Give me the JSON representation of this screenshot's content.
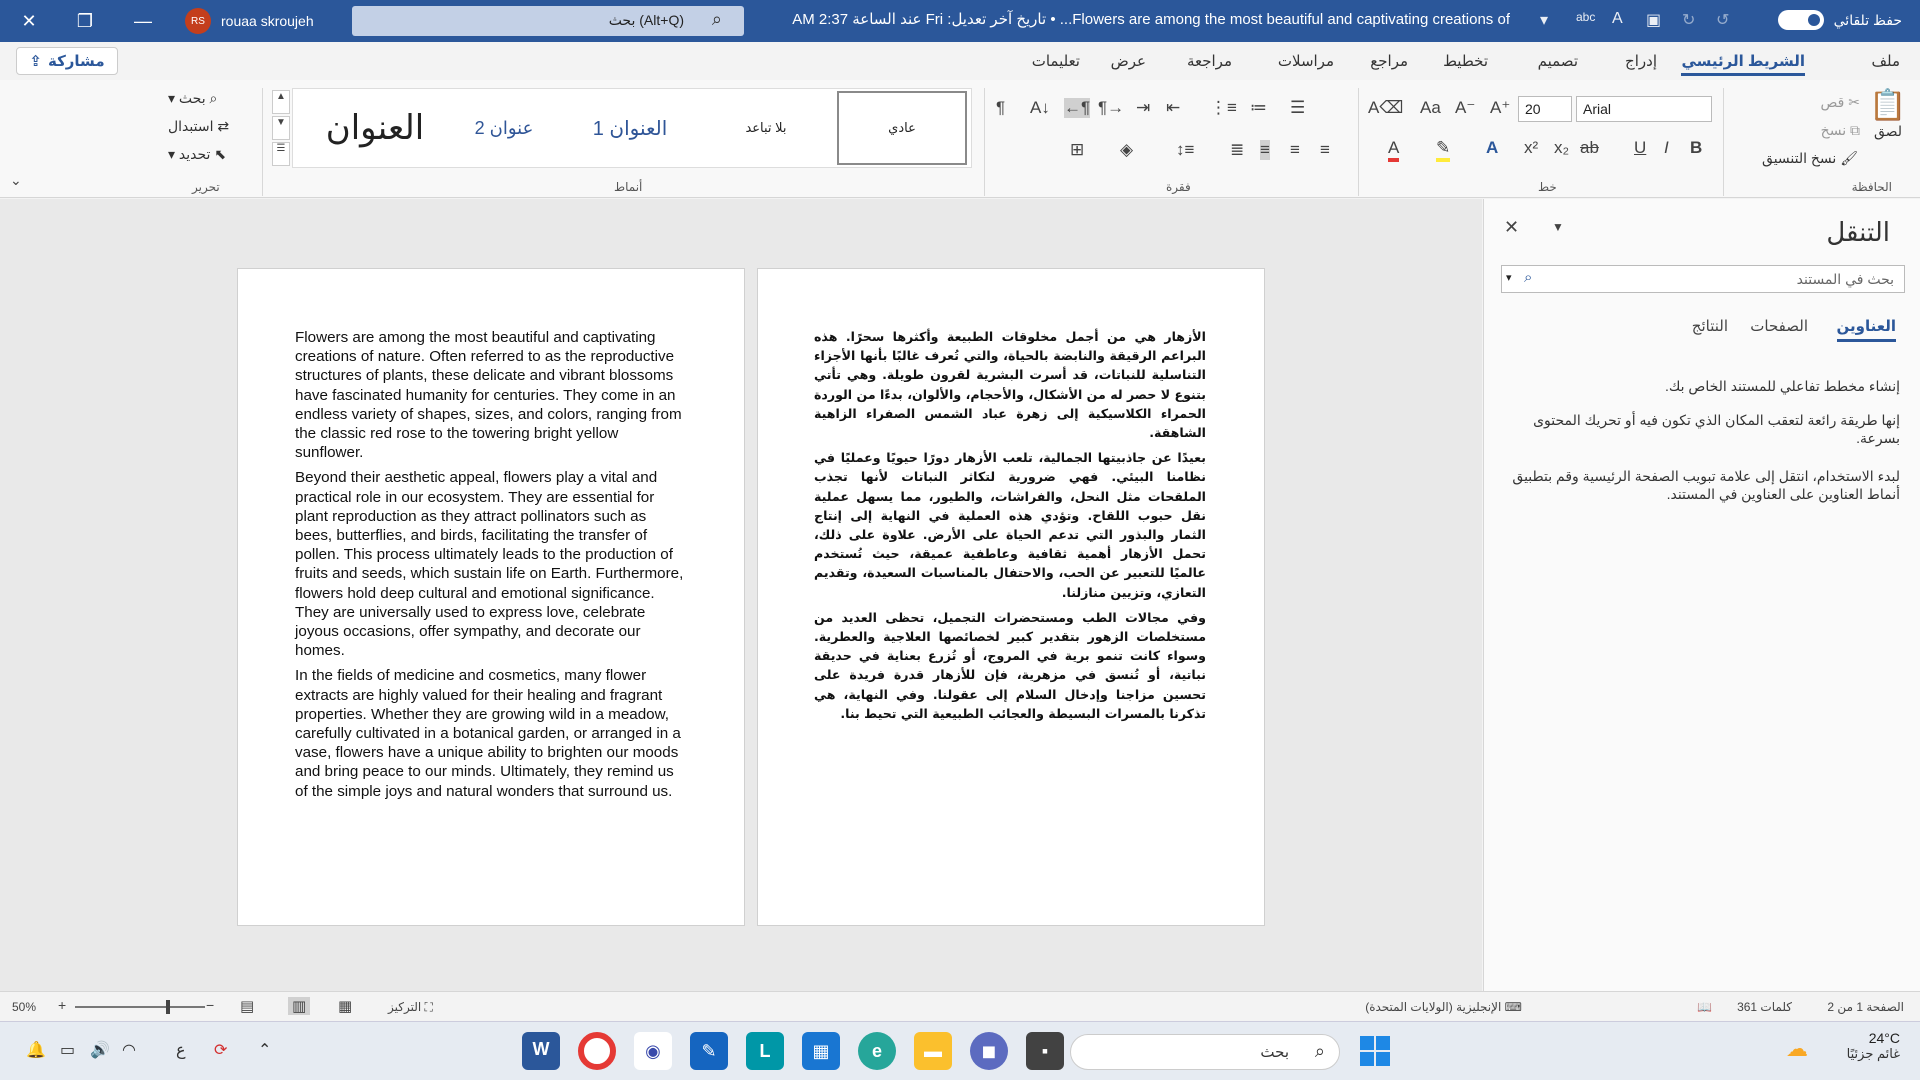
{
  "titlebar": {
    "doc_title": "Flowers are among the most beautiful and captivating creations of... • تاريخ آخر تعديل: Fri عند الساعة 2:37 AM",
    "search_placeholder": "بحث (Alt+Q)",
    "user_name": "rouaa skroujeh",
    "user_initials": "RS",
    "autosave_label": "حفظ تلقائي"
  },
  "tabs": [
    "ملف",
    "الشريط الرئيسي",
    "إدراج",
    "تصميم",
    "تخطيط",
    "مراجع",
    "مراسلات",
    "مراجعة",
    "عرض",
    "تعليمات"
  ],
  "share_label": "مشاركة",
  "ribbon": {
    "clipboard": {
      "label": "الحافظة",
      "paste": "لصق",
      "cut": "قص",
      "copy": "نسخ",
      "format_painter": "نسخ التنسيق"
    },
    "font": {
      "label": "خط",
      "name": "Arial",
      "size": "20"
    },
    "paragraph": {
      "label": "فقرة"
    },
    "styles": {
      "label": "أنماط",
      "items": [
        "عادي",
        "بلا تباعد",
        "العنوان 1",
        "عنوان 2",
        "العنوان"
      ]
    },
    "editing": {
      "label": "تحرير",
      "find": "بحث",
      "replace": "استبدال",
      "select": "تحديد"
    }
  },
  "document": {
    "english_paragraphs": [
      "Flowers are among the most beautiful and captivating creations of nature. Often referred to as the reproductive structures of plants, these delicate and vibrant blossoms have fascinated humanity for centuries. They come in an endless variety of shapes, sizes, and colors, ranging from the classic red rose to the towering bright yellow sunflower.",
      "Beyond their aesthetic appeal, flowers play a vital and practical role in our ecosystem. They are essential for plant reproduction as they attract pollinators such as bees, butterflies, and birds, facilitating the transfer of pollen. This process ultimately leads to the production of fruits and seeds, which sustain life on Earth. Furthermore, flowers hold deep cultural and emotional significance. They are universally used to express love, celebrate joyous occasions, offer sympathy, and decorate our homes.",
      "In the fields of medicine and cosmetics, many flower extracts are highly valued for their healing and fragrant properties. Whether they are growing wild in a meadow, carefully cultivated in a botanical garden, or arranged in a vase, flowers have a unique ability to brighten our moods and bring peace to our minds. Ultimately, they remind us of the simple joys and natural wonders that surround us."
    ],
    "arabic_paragraphs": [
      "الأزهار هي من أجمل مخلوقات الطبيعة وأكثرها سحرًا. هذه البراعم الرقيقة والنابضة بالحياة، والتي تُعرف غالبًا بأنها الأجزاء التناسلية للنباتات، قد أسرت البشرية لقرون طويلة. وهي تأتي بتنوع لا حصر له من الأشكال، والأحجام، والألوان، بدءًا من الوردة الحمراء الكلاسيكية إلى زهرة عباد الشمس الصفراء الزاهية الشاهقة.",
      "بعيدًا عن جاذبيتها الجمالية، تلعب الأزهار دورًا حيويًا وعمليًا في نظامنا البيئي. فهي ضرورية لتكاثر النباتات لأنها تجذب الملقحات مثل النحل، والفراشات، والطيور، مما يسهل عملية نقل حبوب اللقاح. وتؤدي هذه العملية في النهاية إلى إنتاج الثمار والبذور التي تدعم الحياة على الأرض. علاوة على ذلك، تحمل الأزهار أهمية ثقافية وعاطفية عميقة، حيث تُستخدم عالميًا للتعبير عن الحب، والاحتفال بالمناسبات السعيدة، وتقديم التعازي، وتزيين منازلنا.",
      "وفي مجالات الطب ومستحضرات التجميل، تحظى العديد من مستخلصات الزهور بتقدير كبير لخصائصها العلاجية والعطرية. وسواء كانت تنمو برية في المروج، أو تُزرع بعناية في حديقة نباتية، أو تُنسق في مزهرية، فإن للأزهار قدرة فريدة على تحسين مزاجنا وإدخال السلام إلى عقولنا. وفي النهاية، هي تذكرنا بالمسرات البسيطة والعجائب الطبيعية التي تحيط بنا."
    ]
  },
  "navpane": {
    "title": "التنقل",
    "search_placeholder": "بحث في المستند",
    "tabs": [
      "العناوين",
      "الصفحات",
      "النتائج"
    ],
    "help_1": "إنشاء مخطط تفاعلي للمستند الخاص بك.",
    "help_2": "إنها طريقة رائعة لتعقب المكان الذي تكون فيه أو تحريك المحتوى بسرعة.",
    "help_3": "لبدء الاستخدام، انتقل إلى علامة تبويب الصفحة الرئيسية وقم بتطبيق أنماط العناوين على العناوين في المستند."
  },
  "statusbar": {
    "page": "الصفحة 1 من 2",
    "words": "361 كلمات",
    "language": "الإنجليزية (الولايات المتحدة)",
    "focus": "التركيز",
    "zoom": "50%"
  },
  "taskbar": {
    "search_placeholder": "بحث",
    "temperature": "24°C",
    "weather": "غائم جزئيًا",
    "lang": "ع"
  }
}
